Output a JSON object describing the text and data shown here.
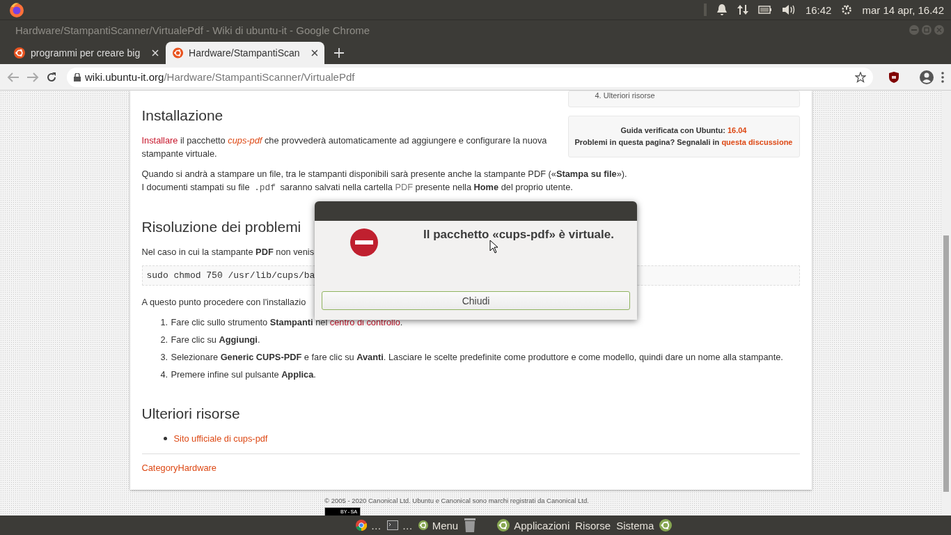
{
  "top_panel": {
    "time": "16:42",
    "date": "mar 14 apr, 16.42"
  },
  "window": {
    "title": "Hardware/StampantiScanner/VirtualePdf - Wiki di ubuntu-it - Google Chrome"
  },
  "tabs": [
    {
      "label": "programmi per creare big",
      "selected": false
    },
    {
      "label": "Hardware/StampantiScan",
      "selected": true
    }
  ],
  "address": {
    "host": "wiki.ubuntu-it.org",
    "path": "/Hardware/StampantiScanner/VirtualePdf"
  },
  "sidebar": {
    "toc_number": "4.",
    "toc_label": "Ulteriori risorse",
    "verified_label": "Guida verificata con Ubuntu:",
    "version": "16.04",
    "problems_label": "Problemi in questa pagina? Segnalali in",
    "problems_link": "questa discussione"
  },
  "blocks": [
    {
      "kind": "heading",
      "text": "Installazione"
    },
    {
      "kind": "paragraph",
      "parts": [
        {
          "kind": "link_red",
          "text": "Installare"
        },
        {
          "kind": "plain",
          "text": " il pacchetto "
        },
        {
          "kind": "link_italic",
          "text": "cups-pdf"
        },
        {
          "kind": "plain",
          "text": " che provvederà automaticamente ad aggiungere e configurare la nuova stampante virtuale."
        }
      ]
    },
    {
      "kind": "paragraph",
      "parts": [
        {
          "kind": "plain",
          "text": "Quando si andrà a stampare un file, tra le stampanti disponibili sarà presente anche la stampante PDF («"
        },
        {
          "kind": "bold",
          "text": "Stampa su file"
        },
        {
          "kind": "plain",
          "text": "»)."
        },
        {
          "kind": "break"
        },
        {
          "kind": "plain",
          "text": "I documenti stampati su file "
        },
        {
          "kind": "code",
          "text": ".pdf"
        },
        {
          "kind": "plain",
          "text": " saranno salvati nella cartella "
        },
        {
          "kind": "muted",
          "text": "PDF"
        },
        {
          "kind": "plain",
          "text": " presente nella "
        },
        {
          "kind": "bold",
          "text": "Home"
        },
        {
          "kind": "plain",
          "text": " del proprio utente."
        }
      ]
    },
    {
      "kind": "heading",
      "text": "Risoluzione dei problemi"
    },
    {
      "kind": "paragraph",
      "parts": [
        {
          "kind": "plain",
          "text": "Nel caso in cui la stampante "
        },
        {
          "kind": "bold",
          "text": "PDF"
        },
        {
          "kind": "plain",
          "text": " non venis"
        }
      ]
    },
    {
      "kind": "code_block",
      "text": "sudo chmod 750 /usr/lib/cups/ba"
    },
    {
      "kind": "paragraph",
      "parts": [
        {
          "kind": "plain",
          "text": "A questo punto procedere con l'installazio"
        }
      ]
    },
    {
      "kind": "ordered_list",
      "items": [
        {
          "number": "1.",
          "parts": [
            {
              "kind": "plain",
              "text": "Fare clic sullo strumento "
            },
            {
              "kind": "bold",
              "text": "Stampanti"
            },
            {
              "kind": "plain",
              "text": " nel "
            },
            {
              "kind": "link_red",
              "text": "centro di controllo"
            },
            {
              "kind": "plain",
              "text": "."
            }
          ]
        },
        {
          "number": "2.",
          "parts": [
            {
              "kind": "plain",
              "text": "Fare clic su "
            },
            {
              "kind": "bold",
              "text": "Aggiungi"
            },
            {
              "kind": "plain",
              "text": "."
            }
          ]
        },
        {
          "number": "3.",
          "parts": [
            {
              "kind": "plain",
              "text": "Selezionare "
            },
            {
              "kind": "bold",
              "text": "Generic CUPS-PDF"
            },
            {
              "kind": "plain",
              "text": " e fare clic su "
            },
            {
              "kind": "bold",
              "text": "Avanti"
            },
            {
              "kind": "plain",
              "text": ". Lasciare le scelte predefinite come produttore e come modello, quindi dare un nome alla stampante."
            }
          ]
        },
        {
          "number": "4.",
          "parts": [
            {
              "kind": "plain",
              "text": "Premere infine sul pulsante "
            },
            {
              "kind": "bold",
              "text": "Applica"
            },
            {
              "kind": "plain",
              "text": "."
            }
          ]
        }
      ]
    },
    {
      "kind": "heading",
      "text": "Ulteriori risorse"
    },
    {
      "kind": "bullet_list",
      "items": [
        {
          "parts": [
            {
              "kind": "link",
              "text": "Sito ufficiale di cups-pdf"
            }
          ]
        }
      ]
    },
    {
      "kind": "rule"
    },
    {
      "kind": "category",
      "text": "CategoryHardware"
    }
  ],
  "footer": {
    "copyright": "© 2005 - 2020 Canonical Ltd. Ubuntu e Canonical sono marchi registrati da Canonical Ltd.",
    "license_badge": "BY-SA"
  },
  "dialog": {
    "message": "Il pacchetto «cups-pdf» è virtuale.",
    "button": "Chiudi"
  },
  "bottom_panel": {
    "items": [
      {
        "kind": "chrome",
        "label": "…"
      },
      {
        "kind": "terminal",
        "label": "…"
      },
      {
        "kind": "menu",
        "label": "Menu"
      },
      {
        "kind": "trash"
      },
      {
        "kind": "ubuntu",
        "label": "Applicazioni"
      },
      {
        "kind": "text",
        "label": "Risorse"
      },
      {
        "kind": "text",
        "label": "Sistema"
      },
      {
        "kind": "ubuntu"
      }
    ]
  }
}
